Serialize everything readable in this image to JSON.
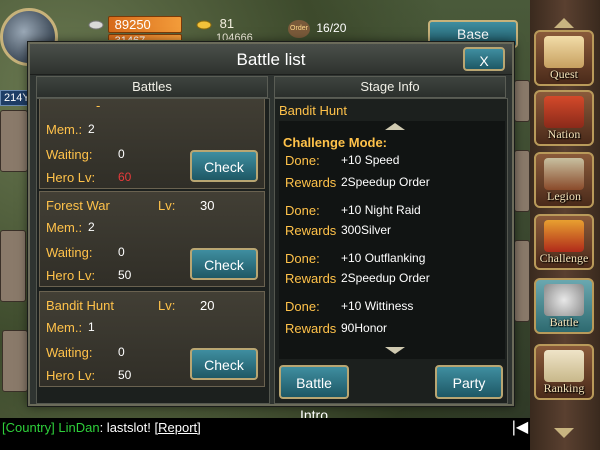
{
  "header": {
    "silver_amount": "89250",
    "second_resource": "31467",
    "gold_amount": "81",
    "third_resource": "104666",
    "order_tag": "Order",
    "order_count": "16/20",
    "base_label": "Base",
    "left_tag": "214Y"
  },
  "sidenav": {
    "items": [
      {
        "label": "Quest",
        "icon": "quest-scroll-icon"
      },
      {
        "label": "Nation",
        "icon": "nation-icon"
      },
      {
        "label": "Legion",
        "icon": "legion-icon"
      },
      {
        "label": "Challenge",
        "icon": "challenge-vs-icon"
      },
      {
        "label": "Battle",
        "icon": "battle-axes-icon"
      },
      {
        "label": "Ranking",
        "icon": "ranking-icon"
      }
    ]
  },
  "modal": {
    "title": "Battle list",
    "close_label": "X",
    "battles_header": "Battles",
    "stage_header": "Stage Info",
    "partial_card": {
      "name": "-",
      "mem_label": "Mem.:",
      "mem_value": "2",
      "waiting_label": "Waiting:",
      "waiting_value": "0",
      "hero_label": "Hero Lv:",
      "hero_value": "60",
      "check_label": "Check"
    },
    "battles": [
      {
        "name": "Forest War",
        "lv_label": "Lv:",
        "lv_value": "30",
        "mem_label": "Mem.:",
        "mem_value": "2",
        "waiting_label": "Waiting:",
        "waiting_value": "0",
        "hero_label": "Hero Lv:",
        "hero_value": "50",
        "check_label": "Check"
      },
      {
        "name": "Bandit Hunt",
        "lv_label": "Lv:",
        "lv_value": "20",
        "mem_label": "Mem.:",
        "mem_value": "1",
        "waiting_label": "Waiting:",
        "waiting_value": "0",
        "hero_label": "Hero Lv:",
        "hero_value": "50",
        "check_label": "Check"
      }
    ],
    "stage": {
      "name": "Bandit Hunt",
      "challenge_title": "Challenge Mode:",
      "entries": [
        {
          "done_label": "Done:",
          "done_value": "+10 Speed",
          "reward_label": "Rewards",
          "reward_value": "2Speedup Order"
        },
        {
          "done_label": "Done:",
          "done_value": "+10 Night Raid",
          "reward_label": "Rewards",
          "reward_value": "300Silver"
        },
        {
          "done_label": "Done:",
          "done_value": "+10 Outflanking",
          "reward_label": "Rewards",
          "reward_value": "2Speedup Order"
        },
        {
          "done_label": "Done:",
          "done_value": "+10 Wittiness",
          "reward_label": "Rewards",
          "reward_value": "90Honor"
        }
      ],
      "intro_label": "Battle Intro",
      "party_label": "Party"
    }
  },
  "chat": {
    "channel": "[Country]",
    "user": "LinDan",
    "message": ": lastslot!",
    "report_label": "[Report]"
  }
}
